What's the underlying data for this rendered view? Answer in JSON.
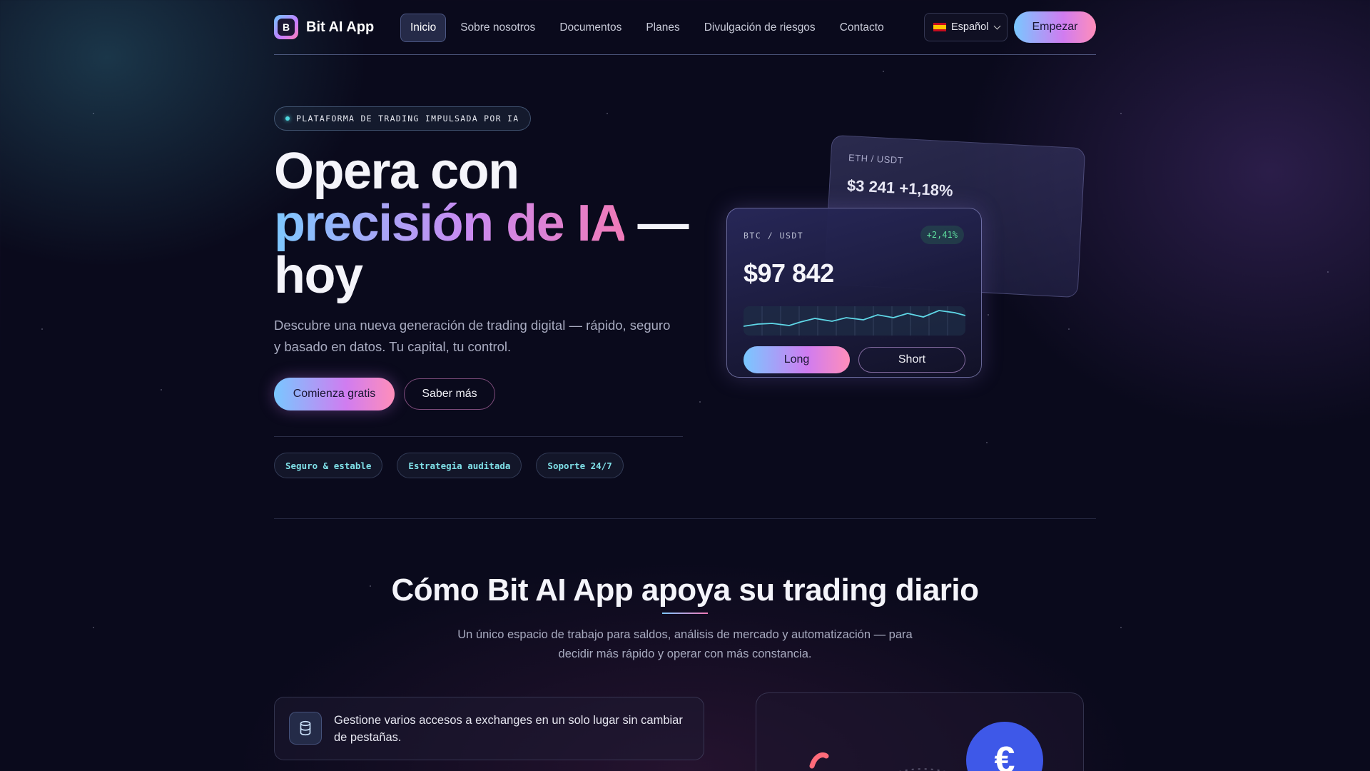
{
  "nav": {
    "brand_initial": "B",
    "brand_name": "Bit AI App",
    "items": [
      {
        "label": "Inicio"
      },
      {
        "label": "Sobre nosotros"
      },
      {
        "label": "Documentos"
      },
      {
        "label": "Planes"
      },
      {
        "label": "Divulgación de riesgos"
      },
      {
        "label": "Contacto"
      }
    ],
    "language": "Español",
    "cta": "Empezar"
  },
  "hero": {
    "tag": "PLATAFORMA DE TRADING IMPULSADA POR IA",
    "title_line1": "Opera con",
    "title_highlight": "precisión de IA",
    "title_dash": " —",
    "title_line3": "hoy",
    "lede": "Descubre una nueva generación de trading digital — rápido, seguro y basado en datos. Tu capital, tu control.",
    "primary_button": "Comienza gratis",
    "secondary_button": "Saber más",
    "chips": [
      "Seguro & estable",
      "Estrategia auditada",
      "Soporte 24/7"
    ]
  },
  "cards": {
    "eth": {
      "pair": "ETH / USDT",
      "price": "$3 241",
      "change": "+1,18%"
    },
    "btc": {
      "pair": "BTC / USDT",
      "price": "$97 842",
      "change": "+2,41%",
      "long": "Long",
      "short": "Short"
    }
  },
  "section": {
    "title": "Cómo Bit AI App apoya su trading diario",
    "subtitle": "Un único espacio de trabajo para saldos, análisis de mercado y automatización — para decidir más rápido y operar con más constancia.",
    "feature_text": "Gestione varios accesos a exchanges en un solo lugar sin cambiar de pestañas.",
    "currency_symbol": "€"
  },
  "colors": {
    "background": "#0a0a1c",
    "accent_cyan": "#7ec8ff",
    "accent_pink": "#f07ab8",
    "positive": "#5fe0a0",
    "euro_badge": "#3e58e8"
  },
  "icons": {
    "feature": "database-icon",
    "language": "spain-flag-icon",
    "dropdown": "chevron-down-icon"
  }
}
